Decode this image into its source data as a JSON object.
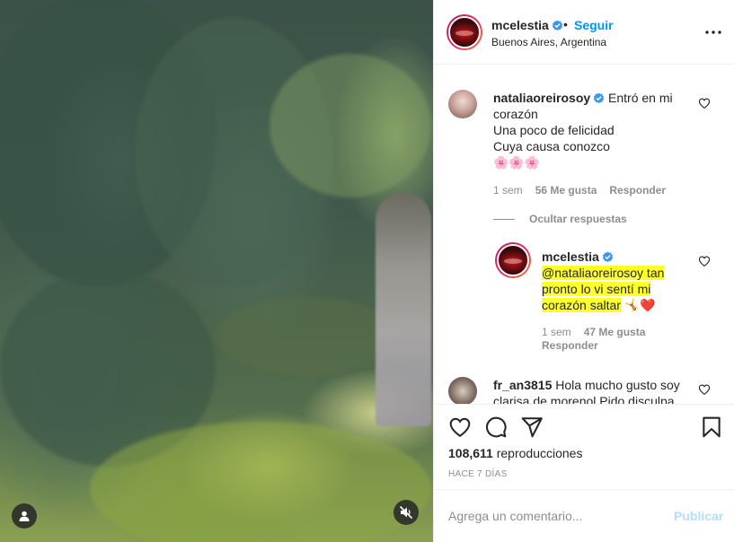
{
  "post": {
    "username": "mcelestia",
    "follow_label": "Seguir",
    "dot": "•",
    "location": "Buenos Aires, Argentina"
  },
  "comments": {
    "partial_top": "",
    "natalia": {
      "username": "nataliaoreirosoy",
      "line1": "Entró en mi",
      "line2": "corazón",
      "line3": "Una poco de felicidad",
      "line4": "Cuya causa conozco",
      "emojis": "🌸🌸🌸",
      "time": "1 sem",
      "likes": "56 Me gusta",
      "reply": "Responder"
    },
    "hide_replies": "Ocultar respuestas",
    "reply": {
      "username": "mcelestia",
      "line1": "@nataliaoreirosoy tan",
      "line2": "pronto lo vi sentí mi",
      "line3": "corazón saltar",
      "emojis": "🤸❤️",
      "time": "1 sem",
      "likes": "47 Me gusta",
      "reply": "Responder"
    },
    "fr": {
      "username": "fr_an3815",
      "line1": "Hola mucho gusto soy",
      "line2": "clarisa de morenol Pido disculpa"
    }
  },
  "actions": {
    "views_count": "108,611",
    "views_label": "reproducciones",
    "age": "HACE 7 DÍAS"
  },
  "add_comment": {
    "placeholder": "Agrega un comentario...",
    "publish_label": "Publicar"
  },
  "icons": {
    "verified": "verified-badge-icon",
    "more": "more-options-icon",
    "like": "heart-icon",
    "comment": "comment-icon",
    "share": "share-icon",
    "save": "bookmark-icon",
    "user_tag": "user-tag-icon",
    "mute": "audio-muted-icon"
  },
  "colors": {
    "link_blue": "#0095f6",
    "publish_disabled": "#b2dffc",
    "highlight": "#ffff2a",
    "secondary_text": "#8e8e8e"
  }
}
